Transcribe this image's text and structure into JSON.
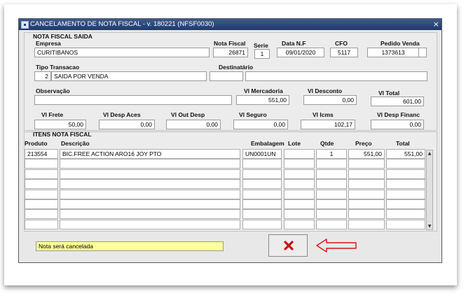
{
  "window": {
    "title": "CANCELAMENTO DE NOTA FISCAL - v. 180221 (NFSF0030)",
    "close_glyph": "×",
    "app_icon": "▪"
  },
  "nota": {
    "section_title": "NOTA FISCAL SAIDA",
    "empresa_label": "Empresa",
    "empresa": "CURITIBANOS",
    "nota_label": "Nota Fiscal",
    "nota": "26871",
    "serie_label": "Serie",
    "serie": "1",
    "data_label": "Data N.F",
    "data": "09/01/2020",
    "cfo_label": "CFO",
    "cfo": "5117",
    "pedido_label": "Pedido Venda",
    "pedido": "1373613",
    "tipo_label": "Tipo Transacao",
    "tipo_code": "2",
    "tipo_desc": "SAIDA POR VENDA",
    "destinatario_label": "Destinatário",
    "destinatario_code": "",
    "destinatario": "",
    "observacao_label": "Observação",
    "observacao": "",
    "vl_mercadoria_label": "Vl Mercadoria",
    "vl_mercadoria": "551,00",
    "vl_desconto_label": "Vl Desconto",
    "vl_desconto": "0,00",
    "vl_total_label": "Vl Total",
    "vl_total": "601,00",
    "vl_frete_label": "Vl Frete",
    "vl_frete": "50,00",
    "vl_desp_aces_label": "Vl Desp Aces",
    "vl_desp_aces": "0,00",
    "vl_out_desp_label": "Vl Out Desp",
    "vl_out_desp": "0,00",
    "vl_seguro_label": "Vl Seguro",
    "vl_seguro": "0,00",
    "vl_icms_label": "Vl Icms",
    "vl_icms": "102,17",
    "vl_desp_financ_label": "Vl Desp Financ",
    "vl_desp_financ": "0,00"
  },
  "itens": {
    "section_title": "ITENS NOTA FISCAL",
    "columns": [
      "Produto",
      "Descrição",
      "Embalagem",
      "Lote",
      "Qtde",
      "Preço",
      "Total"
    ],
    "rows": [
      [
        "213554",
        "BIC.FREE ACTION ARO16 JOY PTO",
        "UN0001UN",
        "",
        "1",
        "551,00",
        "551,00"
      ],
      [
        "",
        "",
        "",
        "",
        "",
        "",
        ""
      ],
      [
        "",
        "",
        "",
        "",
        "",
        "",
        ""
      ],
      [
        "",
        "",
        "",
        "",
        "",
        "",
        ""
      ],
      [
        "",
        "",
        "",
        "",
        "",
        "",
        ""
      ],
      [
        "",
        "",
        "",
        "",
        "",
        "",
        ""
      ],
      [
        "",
        "",
        "",
        "",
        "",
        "",
        ""
      ],
      [
        "",
        "",
        "",
        "",
        "",
        "",
        ""
      ]
    ]
  },
  "status": {
    "message": "Nota será cancelada"
  },
  "scrollbar": {
    "up_glyph": "▲",
    "down_glyph": "▼"
  },
  "colors": {
    "title_bar": "#2a4677",
    "message_bg": "#ffff99",
    "cancel_x": "#cc1111",
    "arrow": "#dd1111"
  }
}
